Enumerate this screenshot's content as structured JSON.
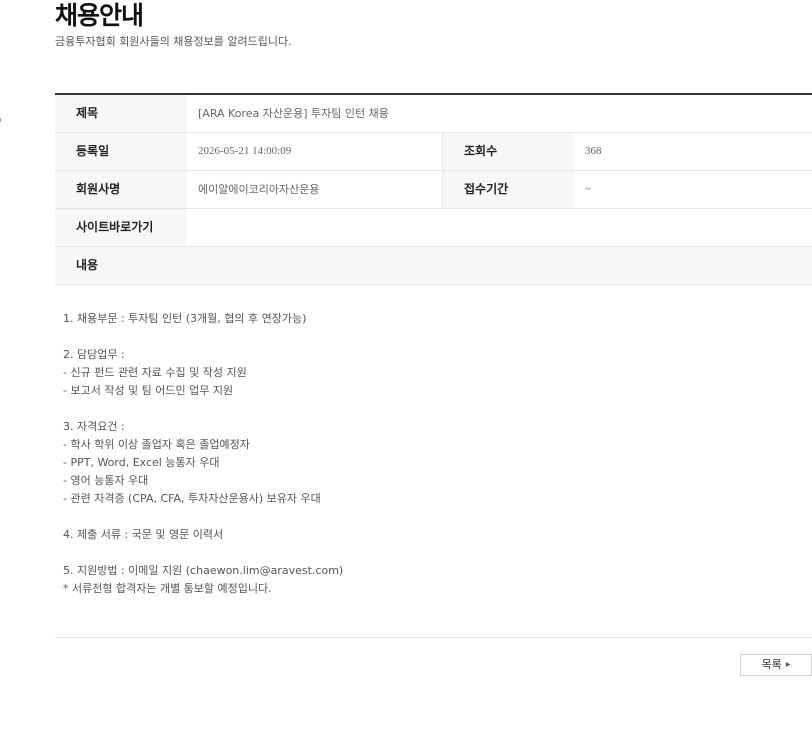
{
  "header": {
    "title": "채용안내",
    "subtitle": "금융투자협회 회원사들의 채용정보를 알려드립니다."
  },
  "detail": {
    "title_label": "제목",
    "title_value": "[ARA Korea 자산운용] 투자팀 인턴 채용",
    "reg_date_label": "등록일",
    "reg_date_value": "2026-05-21 14:00:09",
    "views_label": "조회수",
    "views_value": "368",
    "company_label": "회원사명",
    "company_value": "에이알에이코리아자산운용",
    "period_label": "접수기간",
    "period_value": "~",
    "site_label": "사이트바로가기",
    "site_value": "",
    "content_label": "내용"
  },
  "content_lines": [
    "1. 채용부문 : 투자팀 인턴 (3개월, 협의 후 연장가능)",
    "",
    "2. 담당업무 :",
    "- 신규 펀드 관련 자료 수집 및 작성 지원",
    "- 보고서 작성 및 팀 어드민 업무 지원",
    "",
    "3. 자격요건 :",
    "- 학사 학위 이상 졸업자 혹은 졸업예정자",
    "- PPT, Word, Excel 능통자 우대",
    "- 영어 능통자 우대",
    "- 관련 자격증 (CPA, CFA, 투자자산운용사) 보유자 우대",
    "",
    "4. 제출 서류 : 국문 및 영문 이력서",
    "",
    "5. 지원방법 : 이메일 지원 (chaewon.lim@aravest.com)",
    "* 서류전형 합격자는 개별 통보할 예정입니다."
  ],
  "footer": {
    "list_button_label": "목록",
    "list_button_icon": "caret-right-icon"
  }
}
